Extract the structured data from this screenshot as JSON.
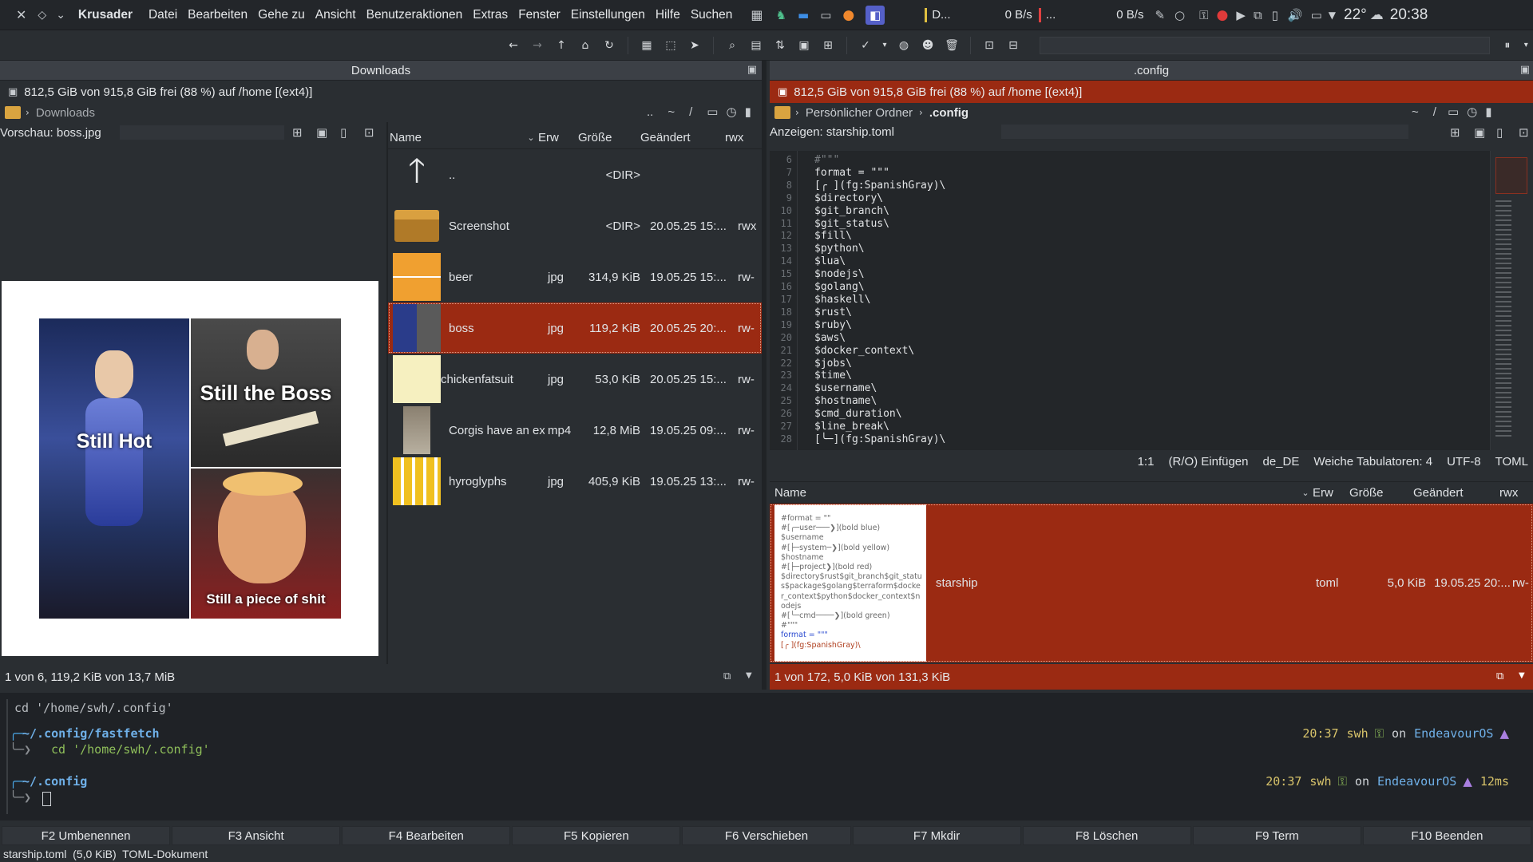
{
  "app": {
    "name": "Krusader"
  },
  "menu": [
    "Datei",
    "Bearbeiten",
    "Gehe zu",
    "Ansicht",
    "Benutzeraktionen",
    "Extras",
    "Fenster",
    "Einstellungen",
    "Hilfe",
    "Suchen"
  ],
  "tray": {
    "task_label": "D...",
    "net_down": "0 B/s",
    "net_up": "0 B/s",
    "task2": "...",
    "weather": "22°",
    "clock": "20:38"
  },
  "left": {
    "title": "Downloads",
    "disk": "812,5 GiB von 915,8 GiB frei (88 %) auf /home [(ext4)]",
    "crumb": "Downloads",
    "preview_label": "Vorschau: boss.jpg",
    "meme": {
      "caption1": "Still Hot",
      "caption2": "Still the Boss",
      "caption3": "Still a piece of shit"
    },
    "columns": {
      "name": "Name",
      "ext": "Erw",
      "size": "Größe",
      "modified": "Geändert",
      "perm": "rwx"
    },
    "files": [
      {
        "name": "..",
        "ext": "",
        "size": "<DIR>",
        "modified": "",
        "perm": ""
      },
      {
        "name": "Screenshot",
        "ext": "",
        "size": "<DIR>",
        "modified": "20.05.25 15:...",
        "perm": "rwx"
      },
      {
        "name": "beer",
        "ext": "jpg",
        "size": "314,9 KiB",
        "modified": "19.05.25 15:...",
        "perm": "rw-"
      },
      {
        "name": "boss",
        "ext": "jpg",
        "size": "119,2 KiB",
        "modified": "20.05.25 20:...",
        "perm": "rw-"
      },
      {
        "name": "chickenfatsuit",
        "ext": "jpg",
        "size": "53,0 KiB",
        "modified": "20.05.25 15:...",
        "perm": "rw-"
      },
      {
        "name": "Corgis have an extr...",
        "ext": "mp4",
        "size": "12,8 MiB",
        "modified": "19.05.25 09:...",
        "perm": "rw-"
      },
      {
        "name": "hyroglyphs",
        "ext": "jpg",
        "size": "405,9 KiB",
        "modified": "19.05.25 13:...",
        "perm": "rw-"
      }
    ],
    "status": "1 von 6, 119,2 KiB von 13,7 MiB"
  },
  "right": {
    "title": ".config",
    "disk": "812,5 GiB von 915,8 GiB frei (88 %) auf /home [(ext4)]",
    "crumb_home": "Persönlicher Ordner",
    "crumb_dir": ".config",
    "viewer_label": "Anzeigen: starship.toml",
    "code_start_line": 6,
    "code": [
      "#\"\"\"",
      "",
      "format = \"\"\"",
      "[╭ ](fg:SpanishGray)\\",
      "$directory\\",
      "$git_branch\\",
      "$git_status\\",
      "$fill\\",
      "$python\\",
      "$lua\\",
      "$nodejs\\",
      "$golang\\",
      "$haskell\\",
      "$rust\\",
      "$ruby\\",
      "$aws\\",
      "$docker_context\\",
      "$jobs\\",
      "$time\\",
      "$username\\",
      "$hostname\\",
      "$cmd_duration\\",
      "$line_break\\",
      "[╰─](fg:SpanishGray)\\"
    ],
    "editor_status": {
      "pos": "1:1",
      "mode": "(R/O) Einfügen",
      "lang": "de_DE",
      "tabs": "Weiche Tabulatoren: 4",
      "enc": "UTF-8",
      "type": "TOML"
    },
    "columns": {
      "name": "Name",
      "ext": "Erw",
      "size": "Größe",
      "modified": "Geändert",
      "perm": "rwx"
    },
    "thumb_lines": [
      "#format = \"\"",
      "#[╭─user───❯](bold blue)",
      "$username",
      "#[├─system─❯](bold yellow)",
      "$hostname",
      "#[├─project❯](bold red)",
      "$directory$rust$git_branch$git_statu",
      "s$package$golang$terraform$docke",
      "r_context$python$docker_context$n",
      "odejs",
      "#[╰─cmd────❯](bold green)",
      "#\"\"\"",
      "",
      "format = \"\"\"",
      "[╭ ](fg:SpanishGray)\\"
    ],
    "file": {
      "name": "starship",
      "ext": "toml",
      "size": "5,0 KiB",
      "modified": "19.05.25 20:...",
      "perm": "rw-"
    },
    "status": "1 von 172, 5,0 KiB von 131,3 KiB"
  },
  "terminal": {
    "line1": "cd '/home/swh/.config'",
    "p1_dir": "~/.config/fastfetch",
    "p1_cmd": "cd '/home/swh/.config'",
    "p1_time": "20:37",
    "user": "swh",
    "on": "on",
    "os": "EndeavourOS",
    "p2_dir": "~/.config",
    "p2_time": "20:37",
    "p2_dur": "12ms"
  },
  "fkeys": [
    "F2 Umbenennen",
    "F3 Ansicht",
    "F4 Bearbeiten",
    "F5 Kopieren",
    "F6 Verschieben",
    "F7 Mkdir",
    "F8 Löschen",
    "F9 Term",
    "F10 Beenden"
  ],
  "bottom_status": "starship.toml  (5,0 KiB)  TOML-Dokument",
  "colors": {
    "selection": "#9b2a12",
    "accent_green": "#8fbf5a",
    "accent_yellow": "#d7c36a",
    "accent_blue": "#6fb0e8"
  }
}
